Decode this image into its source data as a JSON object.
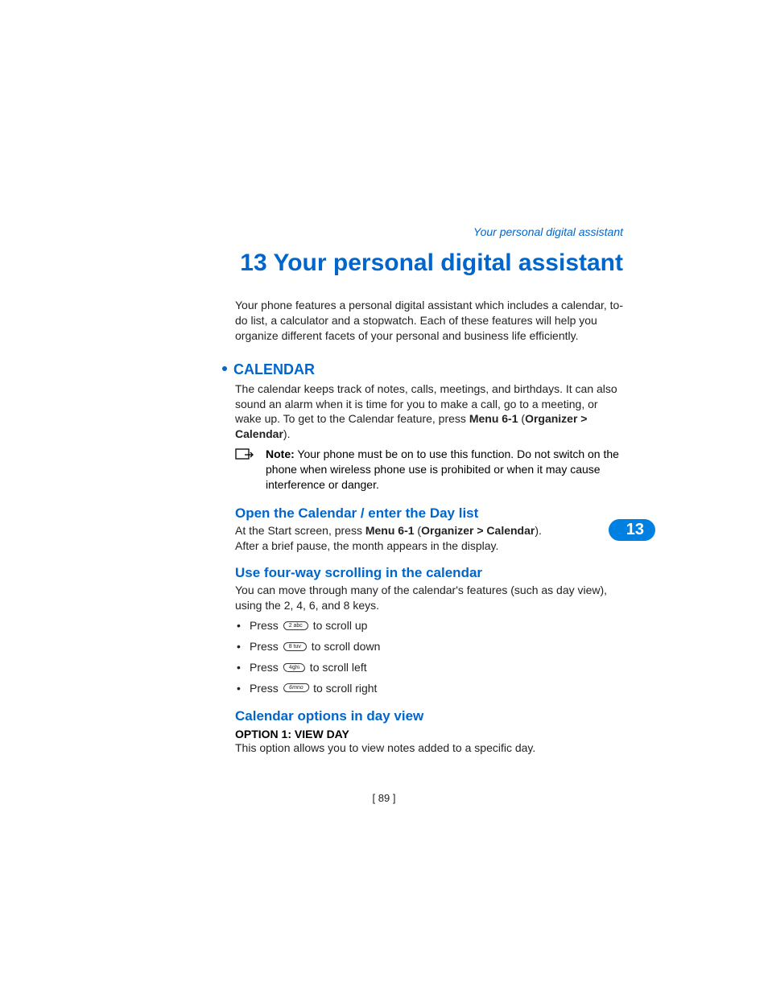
{
  "running_header": "Your personal digital assistant",
  "chapter_number": "13",
  "chapter_title": "Your personal digital assistant",
  "intro": "Your phone features a personal digital assistant which includes a calendar, to-do list, a calculator and a stopwatch. Each of these features will help you organize different facets of your personal and business life efficiently.",
  "calendar": {
    "heading": "CALENDAR",
    "para_a": "The calendar keeps track of notes, calls, meetings, and birthdays. It can also sound an alarm when it is time for you to make a call, go to a meeting, or wake up. To get to the Calendar feature, press ",
    "menu_ref": "Menu 6-1",
    "para_b": " (",
    "menu_path": "Organizer > Calendar",
    "para_c": ").",
    "note_label": "Note:",
    "note_body": " Your phone must be on to use this function. Do not switch on the phone when wireless phone use is prohibited or when it may cause interference or danger."
  },
  "open_calendar": {
    "heading": "Open the Calendar / enter the Day list",
    "a": "At the Start screen, press ",
    "menu_ref": "Menu 6-1",
    "b": " (",
    "menu_path": "Organizer > Calendar",
    "c": "). After a brief pause, the month appears in the display."
  },
  "scrolling": {
    "heading": "Use four-way scrolling in the calendar",
    "intro": "You can move through many of the calendar's features (such as day view), using the 2, 4, 6, and 8 keys.",
    "items": [
      {
        "prefix": "Press ",
        "key": "2 abc",
        "suffix": " to scroll up"
      },
      {
        "prefix": "Press ",
        "key": "8 tuv",
        "suffix": " to scroll down"
      },
      {
        "prefix": "Press ",
        "key": "4ghi",
        "suffix": " to scroll left"
      },
      {
        "prefix": "Press ",
        "key": "6mno",
        "suffix": " to scroll right"
      }
    ]
  },
  "day_view": {
    "heading": "Calendar options in day view",
    "option_head": "OPTION 1: VIEW DAY",
    "option_body": "This option allows you to view notes added to a specific day."
  },
  "tab_number": "13",
  "page_number": "[ 89 ]"
}
